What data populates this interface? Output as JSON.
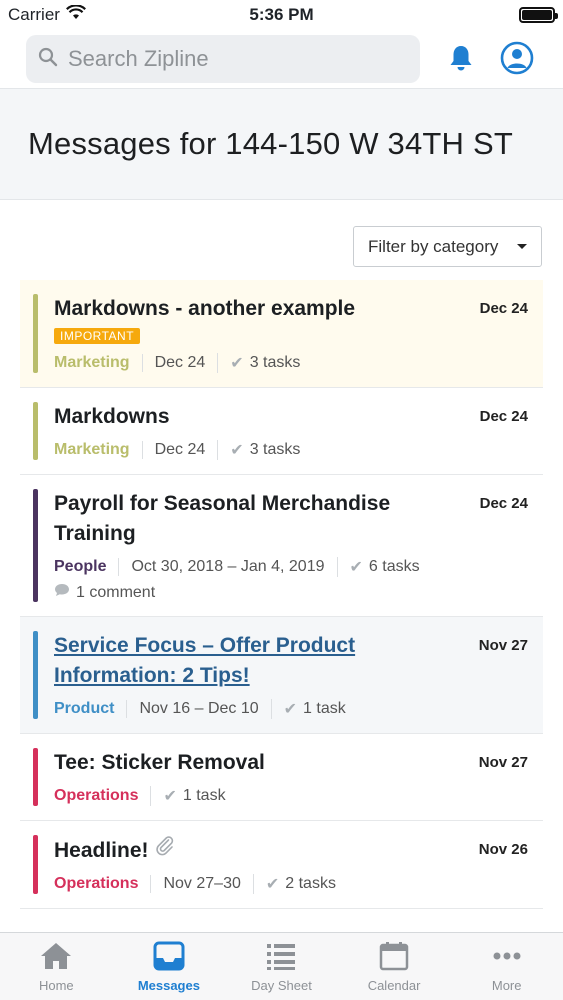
{
  "status": {
    "carrier": "Carrier",
    "time": "5:36 PM"
  },
  "search": {
    "placeholder": "Search Zipline"
  },
  "page": {
    "title": "Messages for 144-150 W 34TH ST"
  },
  "filter": {
    "label": "Filter by category"
  },
  "colors": {
    "marketing": "#b9bd6b",
    "people": "#4b3460",
    "product": "#3f8fc6",
    "operations": "#d5305b",
    "accent": "#1f7fd1",
    "badge": "#f6a90d"
  },
  "messages": [
    {
      "title": "Markdowns - another example",
      "date": "Dec 24",
      "badge": "IMPORTANT",
      "category": "Marketing",
      "range": "Dec 24",
      "tasks": "3 tasks"
    },
    {
      "title": "Markdowns",
      "date": "Dec 24",
      "category": "Marketing",
      "range": "Dec 24",
      "tasks": "3 tasks"
    },
    {
      "title_line1": "Payroll for Seasonal Merchandise",
      "title_line2": "Training",
      "date": "Dec 24",
      "category": "People",
      "range": "Oct 30, 2018 – Jan 4, 2019",
      "tasks": "6 tasks",
      "comments": "1 comment"
    },
    {
      "title_line1": "Service Focus – Offer Product",
      "title_line2": "Information: 2 Tips!",
      "date": "Nov 27",
      "category": "Product",
      "range": "Nov 16 – Dec 10",
      "tasks": "1 task"
    },
    {
      "title": "Tee: Sticker Removal",
      "date": "Nov 27",
      "category": "Operations",
      "tasks": "1 task"
    },
    {
      "title": "Headline!",
      "date": "Nov 26",
      "category": "Operations",
      "range": "Nov 27–30",
      "tasks": "2 tasks"
    }
  ],
  "tabs": [
    {
      "label": "Home",
      "icon": "home-icon"
    },
    {
      "label": "Messages",
      "icon": "inbox-icon",
      "active": true
    },
    {
      "label": "Day Sheet",
      "icon": "list-icon"
    },
    {
      "label": "Calendar",
      "icon": "calendar-icon"
    },
    {
      "label": "More",
      "icon": "more-icon"
    }
  ]
}
